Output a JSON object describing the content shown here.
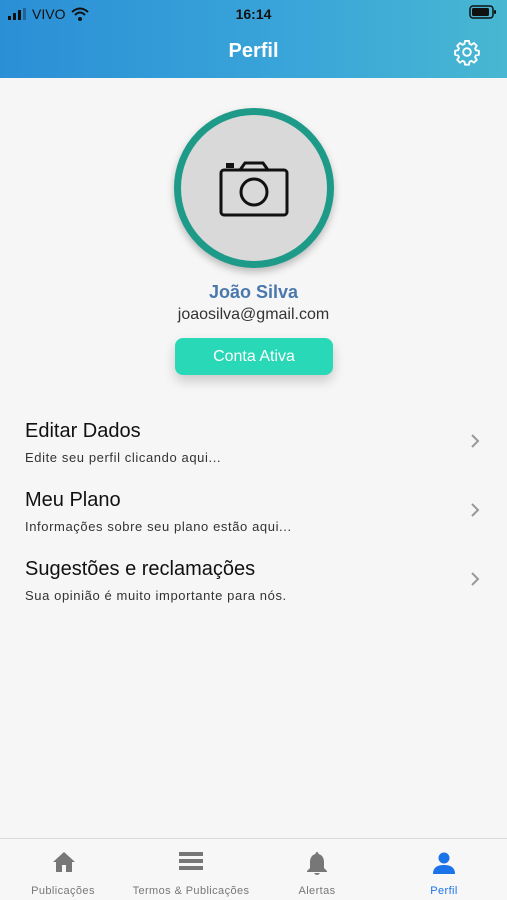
{
  "status_bar": {
    "carrier": "VIVO",
    "time": "16:14"
  },
  "header": {
    "title": "Perfil"
  },
  "profile": {
    "name": "João Silva",
    "email": "joaosilva@gmail.com",
    "status_badge": "Conta Ativa"
  },
  "menu": [
    {
      "title": "Editar Dados",
      "subtitle": "Edite seu perfil clicando aqui..."
    },
    {
      "title": "Meu Plano",
      "subtitle": "Informações sobre seu plano estão aqui..."
    },
    {
      "title": "Sugestões e reclamações",
      "subtitle": "Sua opinião é muito importante para nós."
    }
  ],
  "tabs": [
    {
      "label": "Publicações",
      "icon": "home-icon",
      "active": false
    },
    {
      "label": "Termos & Publicações",
      "icon": "list-icon",
      "active": false
    },
    {
      "label": "Alertas",
      "icon": "bell-icon",
      "active": false
    },
    {
      "label": "Perfil",
      "icon": "person-icon",
      "active": true
    }
  ],
  "colors": {
    "header_start": "#2b8fd6",
    "header_end": "#48b7d1",
    "ring": "#1e9a88",
    "badge": "#28d8b7",
    "name": "#4a78ad",
    "active_tab": "#1a73e8"
  }
}
